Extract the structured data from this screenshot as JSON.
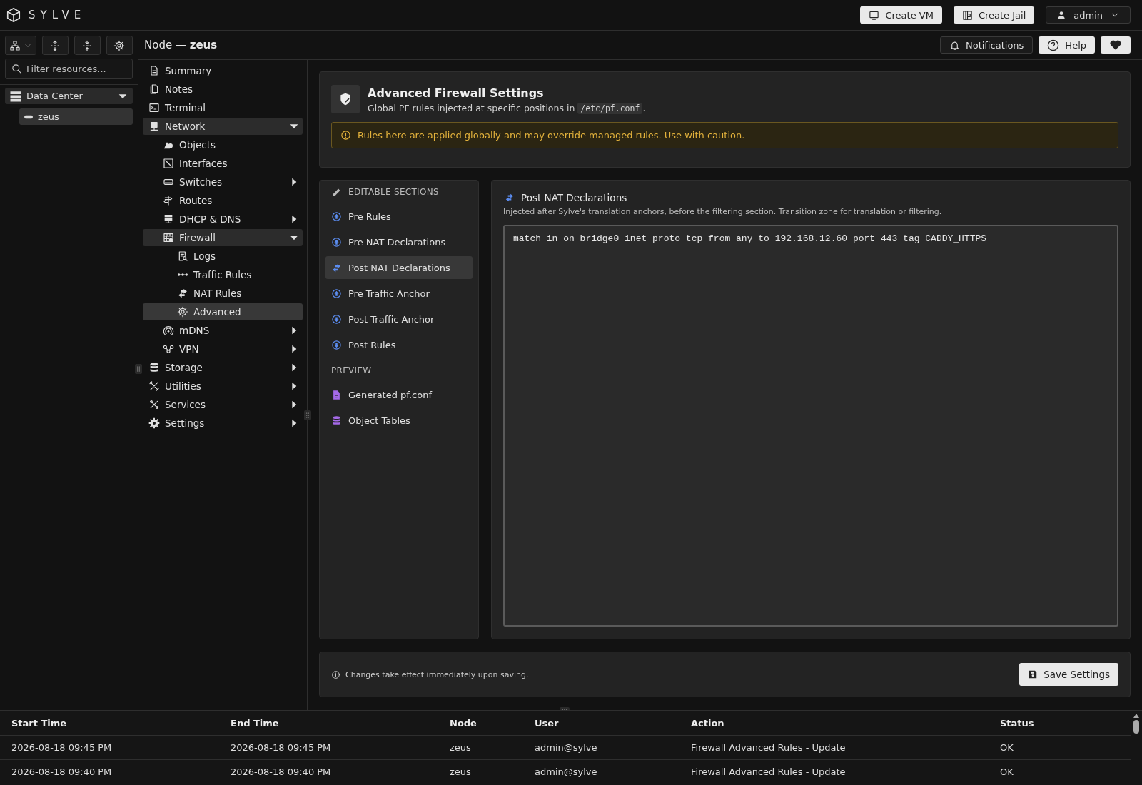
{
  "header": {
    "brand": "SYLVE",
    "buttons": [
      {
        "kind": "vm",
        "label": "Create VM"
      },
      {
        "kind": "jail",
        "label": "Create Jail"
      }
    ],
    "user_menu": "admin"
  },
  "resources": {
    "search": {
      "placeholder": "Filter resources..."
    },
    "tree": [
      {
        "label": "Data Center",
        "expanded": true,
        "children": [
          {
            "label": "zeus",
            "selected": true
          }
        ]
      }
    ]
  },
  "node_bar": {
    "title": "Node — **zeus**",
    "notifications": "Notifications",
    "help": "Help"
  },
  "nav": {
    "items": [
      {
        "label": "Summary",
        "selected": false
      },
      {
        "label": "Notes",
        "selected": false
      },
      {
        "label": "Terminal",
        "selected": false
      },
      {
        "label": "Network",
        "selected": false,
        "expanded": true,
        "children": [
          {
            "label": "Objects",
            "selected": false
          },
          {
            "label": "Interfaces",
            "selected": false
          },
          {
            "label": "Switches",
            "selected": false,
            "expanded": false
          },
          {
            "label": "Routes",
            "selected": false
          },
          {
            "label": "DHCP & DNS",
            "selected": false,
            "expanded": false
          },
          {
            "label": "Firewall",
            "selected": false,
            "expanded": true,
            "children": [
              {
                "label": "Logs",
                "selected": false
              },
              {
                "label": "Traffic Rules",
                "selected": false
              },
              {
                "label": "NAT Rules",
                "selected": false
              },
              {
                "label": "Advanced",
                "selected": true
              }
            ]
          },
          {
            "label": "mDNS",
            "selected": false,
            "expanded": false
          },
          {
            "label": "VPN",
            "selected": false,
            "expanded": false
          }
        ]
      },
      {
        "label": "Storage",
        "selected": false,
        "expanded": false
      },
      {
        "label": "Utilities",
        "selected": false,
        "expanded": false
      },
      {
        "label": "Services",
        "selected": false,
        "expanded": false
      },
      {
        "label": "Settings",
        "selected": false,
        "expanded": false
      }
    ]
  },
  "page": {
    "title": "Advanced Firewall Settings",
    "subtitle": {
      "text_before": "Global PF rules injected at specific positions in ",
      "path": "/etc/pf.conf",
      "text_after": "."
    },
    "warning": "Rules here are applied globally and may override managed rules. Use with caution."
  },
  "sections": {
    "heading": "EDITABLE SECTIONS",
    "items": [
      {
        "kind": "up",
        "label": "Pre Rules",
        "selected": false
      },
      {
        "kind": "up",
        "label": "Pre NAT Declarations",
        "selected": false
      },
      {
        "kind": "swap",
        "label": "Post NAT Declarations",
        "selected": true
      },
      {
        "kind": "up",
        "label": "Pre Traffic Anchor",
        "selected": false
      },
      {
        "kind": "down",
        "label": "Post Traffic Anchor",
        "selected": false
      },
      {
        "kind": "down",
        "label": "Post Rules",
        "selected": false
      }
    ],
    "preview_heading": "PREVIEW",
    "preview_items": [
      {
        "kind": "file",
        "label": "Generated pf.conf",
        "selected": false
      },
      {
        "kind": "db",
        "label": "Object Tables",
        "selected": false
      }
    ]
  },
  "editor": {
    "title": "Post NAT Declarations",
    "description": "Injected after Sylve's translation anchors, before the filtering section. Transition zone for translation or filtering.",
    "value": "match in on bridge0 inet proto tcp from any to 192.168.12.60 port 443 tag CADDY_HTTPS"
  },
  "footer": {
    "note": "Changes take effect immediately upon saving.",
    "save_button": "Save Settings"
  },
  "table": {
    "columns": [
      "Start Time",
      "End Time",
      "Node",
      "User",
      "Action",
      "Status"
    ],
    "rows": [
      [
        "2026-08-18 09:45 PM",
        "2026-08-18 09:45 PM",
        "zeus",
        "admin@sylve",
        "Firewall Advanced Rules - Update",
        "OK"
      ],
      [
        "2026-08-18 09:40 PM",
        "2026-08-18 09:40 PM",
        "zeus",
        "admin@sylve",
        "Firewall Advanced Rules - Update",
        "OK"
      ]
    ]
  }
}
